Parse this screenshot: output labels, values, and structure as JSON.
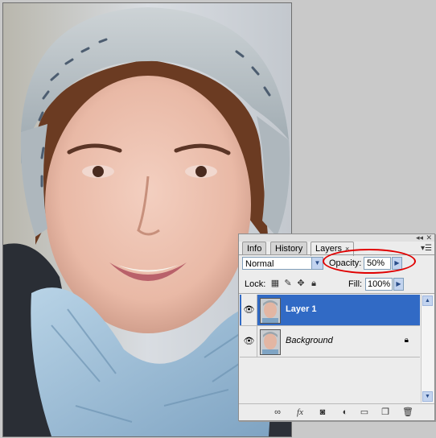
{
  "photo": {
    "description_icon": "portrait-image"
  },
  "layers_panel": {
    "tabs": [
      {
        "label": "Info",
        "active": false
      },
      {
        "label": "History",
        "active": false
      },
      {
        "label": "Layers",
        "active": true,
        "close": "×"
      }
    ],
    "blend_mode": "Normal",
    "opacity_label": "Opacity:",
    "opacity_value": "50%",
    "lock_label": "Lock:",
    "fill_label": "Fill:",
    "fill_value": "100%",
    "layers": [
      {
        "name": "Layer 1",
        "visible": true,
        "selected": true,
        "locked": false
      },
      {
        "name": "Background",
        "visible": true,
        "selected": false,
        "locked": true
      }
    ],
    "highlight_color": "#316ac5",
    "annotation_color": "#e00000",
    "footer_icons": [
      "link-icon",
      "fx-icon",
      "mask-icon",
      "adjustment-icon",
      "folder-icon",
      "new-layer-icon",
      "trash-icon"
    ],
    "footer_fx_label": "fx"
  }
}
